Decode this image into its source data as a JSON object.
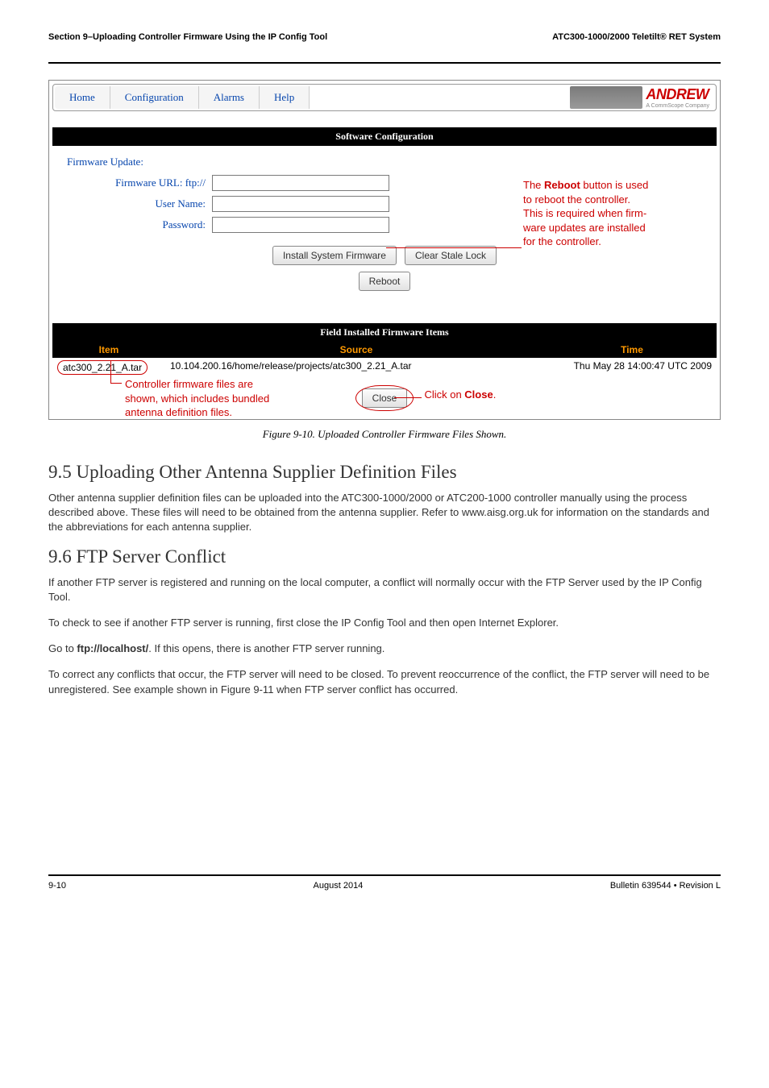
{
  "header": {
    "left": "Section 9–Uploading Controller Firmware Using the IP Config Tool",
    "right": "ATC300-1000/2000 Teletilt® RET System"
  },
  "tabs": {
    "home": "Home",
    "config": "Configuration",
    "alarms": "Alarms",
    "help": "Help"
  },
  "brand": {
    "name": "ANDREW",
    "sub": "A CommScope Company"
  },
  "sw_config": {
    "bar": "Software Configuration",
    "subhead": "Firmware Update:",
    "labels": {
      "url": "Firmware URL: ftp://",
      "user": "User Name:",
      "pass": "Password:"
    },
    "values": {
      "url": "",
      "user": "",
      "pass": ""
    },
    "buttons": {
      "install": "Install System Firmware",
      "clear": "Clear Stale Lock",
      "reboot": "Reboot"
    },
    "annot": {
      "l1": "The ",
      "l1b": "Reboot",
      "l1c": " button is used",
      "l2": "to reboot the controller.",
      "l3": "This is required when firm-",
      "l4": "ware updates are installed",
      "l5": "for the controller."
    }
  },
  "fw_table": {
    "bar": "Field Installed Firmware Items",
    "head": {
      "item": "Item",
      "source": "Source",
      "time": "Time"
    },
    "row": {
      "item": "atc300_2.21_A.tar",
      "source": "10.104.200.16/home/release/projects/atc300_2.21_A.tar",
      "time": "Thu May 28 14:00:47 UTC 2009"
    }
  },
  "close": {
    "btn": "Close",
    "left": {
      "l1": "Controller firmware files are",
      "l2": "shown, which includes bundled",
      "l3": "antenna definition files."
    },
    "right": {
      "pre": "Click on ",
      "bold": "Close",
      "post": "."
    }
  },
  "caption": "Figure 9-10.  Uploaded Controller Firmware Files Shown.",
  "sec95": {
    "h": "9.5 Uploading Other Antenna Supplier Definition Files",
    "p": "Other antenna supplier definition files can be uploaded into the ATC300-1000/2000 or ATC200-1000 controller manually using the process described above. These files will need to be obtained from the antenna supplier. Refer to www.aisg.org.uk for information on the standards and the abbreviations for each antenna supplier."
  },
  "sec96": {
    "h": "9.6 FTP Server Conflict",
    "p1": "If another FTP server is registered and running on the local computer, a conflict will normally occur with the FTP Server used by the IP Config Tool.",
    "p2": "To check to see if another FTP server is running, first close the IP Config Tool and then open Internet Explorer.",
    "p3a": "Go to ",
    "p3b": "ftp://localhost/",
    "p3c": ". If this opens, there is another FTP server running.",
    "p4": "To correct any conflicts that occur, the FTP server will need to be closed. To prevent reoccurrence of the conflict, the FTP server will need to be unregistered. See example shown in Figure 9-11 when FTP server conflict has occurred."
  },
  "footer": {
    "left": "9-10",
    "center": "August 2014",
    "right": "Bulletin 639544  •  Revision L"
  }
}
